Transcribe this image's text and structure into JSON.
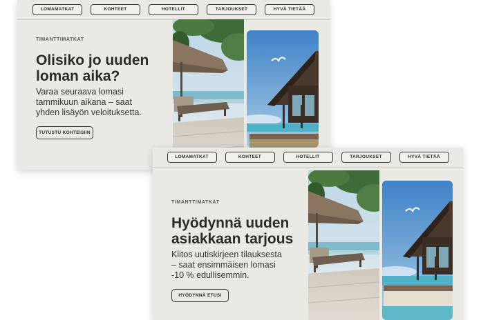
{
  "nav": [
    "LOMAMATKAT",
    "KOHTEET",
    "HOTELLIT",
    "TARJOUKSET",
    "HYVÄ TIETÄÄ"
  ],
  "card_one": {
    "eyebrow": "TIMANTTIMATKAT",
    "headline_line1": "Olisiko jo uuden",
    "headline_line2": "loman aika?",
    "body_line1": "Varaa seuraava lomasi",
    "body_line2": "tammikuun aikana – saat",
    "body_line3": "yhden lisäyön veloituksetta.",
    "cta": "TUTUSTU KOHTEISIIN"
  },
  "card_two": {
    "eyebrow": "TIMANTTIMATKAT",
    "headline_line1": "Hyödynnä uuden",
    "headline_line2": "asiakkaan tarjous",
    "body_line1": "Kiitos uutiskirjeen tilauksesta",
    "body_line2": "– saat ensimmäisen lomasi",
    "body_line3": "-10 % edullisemmin.",
    "cta": "HYÖDYNNÄ ETUSI"
  }
}
